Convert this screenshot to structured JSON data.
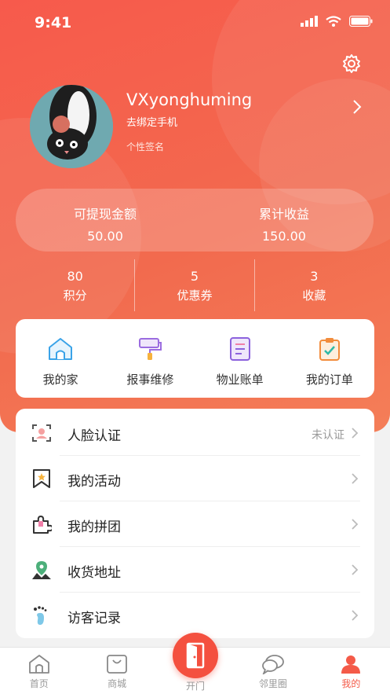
{
  "status_bar": {
    "time": "9:41"
  },
  "profile": {
    "username": "VXyonghuming",
    "bind_phone": "去绑定手机",
    "signature": "个性签名"
  },
  "balance": {
    "withdrawable_label": "可提现金额",
    "withdrawable_value": "50.00",
    "earnings_label": "累计收益",
    "earnings_value": "150.00"
  },
  "stats": [
    {
      "value": "80",
      "label": "积分"
    },
    {
      "value": "5",
      "label": "优惠券"
    },
    {
      "value": "3",
      "label": "收藏"
    }
  ],
  "quick_actions": [
    {
      "label": "我的家",
      "icon": "house-icon"
    },
    {
      "label": "报事维修",
      "icon": "paint-roller-icon"
    },
    {
      "label": "物业账单",
      "icon": "bill-icon"
    },
    {
      "label": "我的订单",
      "icon": "clipboard-check-icon"
    }
  ],
  "menu": [
    {
      "label": "人脸认证",
      "status": "未认证",
      "icon": "face-scan-icon"
    },
    {
      "label": "我的活动",
      "status": "",
      "icon": "bookmark-star-icon"
    },
    {
      "label": "我的拼团",
      "status": "",
      "icon": "puzzle-icon"
    },
    {
      "label": "收货地址",
      "status": "",
      "icon": "location-pin-icon"
    },
    {
      "label": "访客记录",
      "status": "",
      "icon": "footprint-icon"
    }
  ],
  "tabbar": [
    {
      "label": "首页",
      "icon": "home-icon"
    },
    {
      "label": "商城",
      "icon": "shopping-bag-icon"
    },
    {
      "label": "开门",
      "icon": "door-icon"
    },
    {
      "label": "邻里圈",
      "icon": "chat-bubbles-icon"
    },
    {
      "label": "我的",
      "icon": "person-icon"
    }
  ],
  "colors": {
    "accent": "#f45a48",
    "hero_start": "#f75a4c",
    "hero_end": "#f47e58"
  }
}
